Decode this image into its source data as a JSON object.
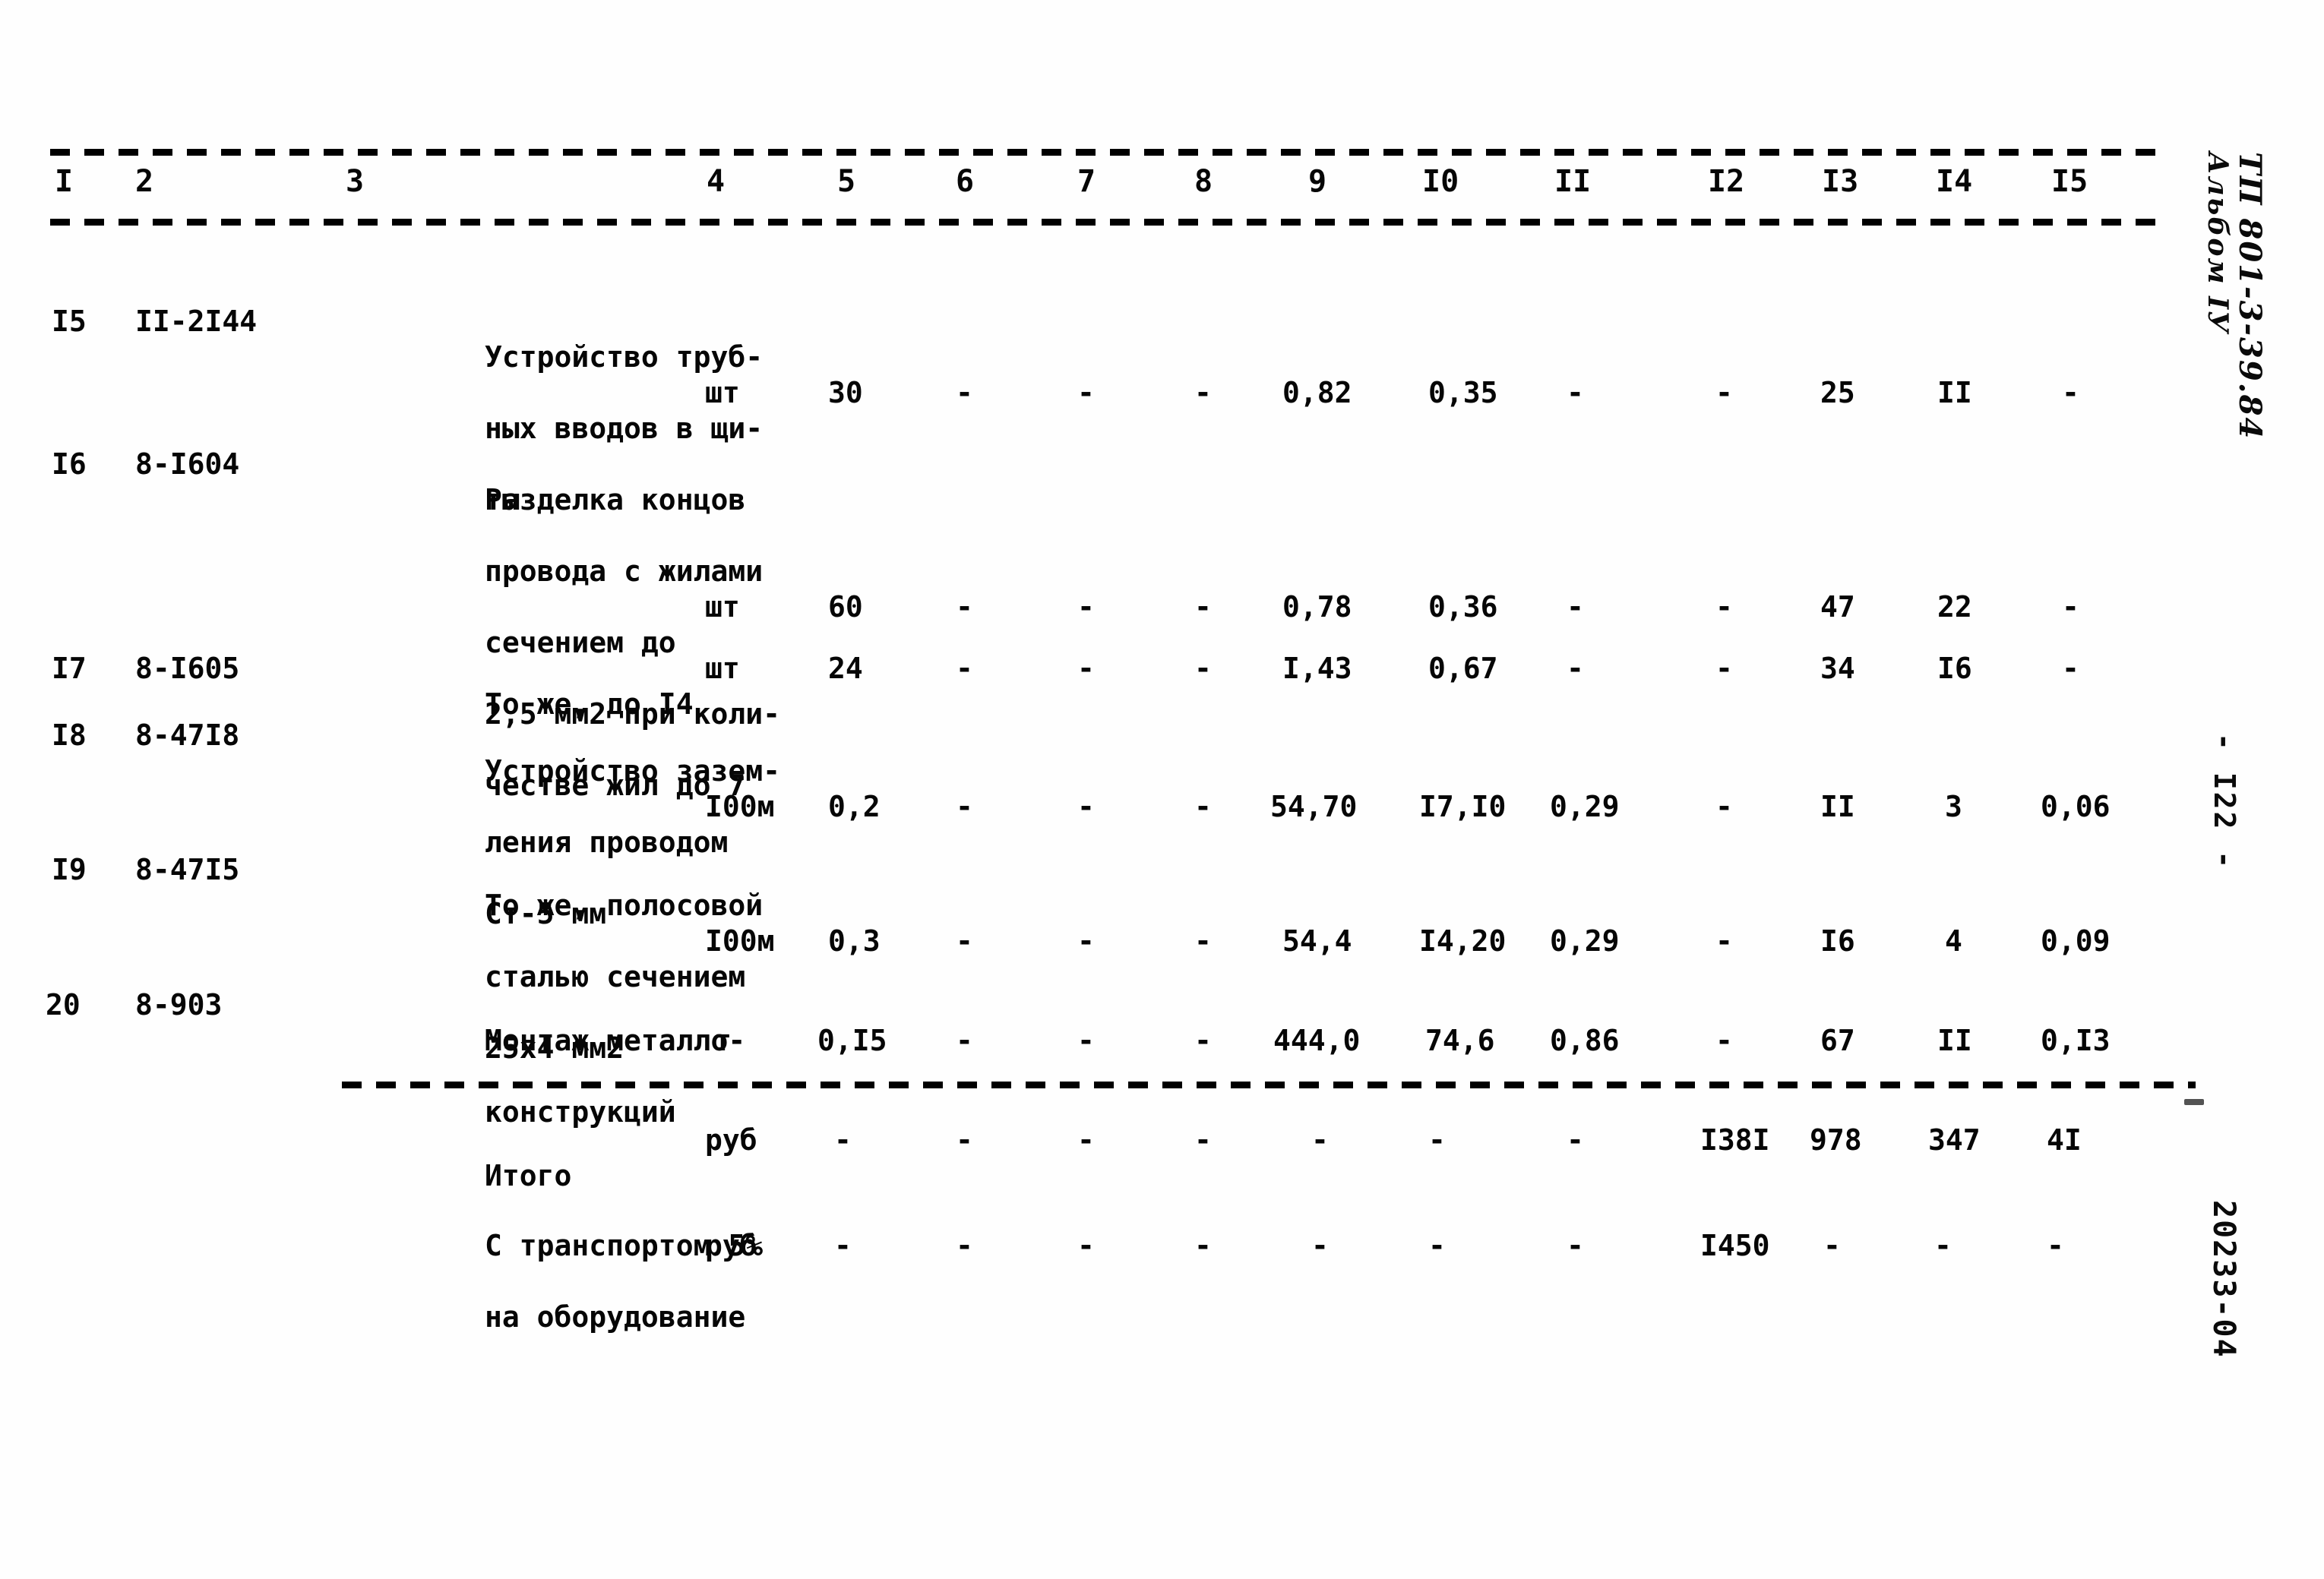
{
  "document": {
    "type": "scanned-cost-estimate-table",
    "page_label": "- I22 -",
    "margin_code_top": "ТП 801-3-39.84",
    "margin_code_album": "Альбом IУ",
    "margin_stamp": "20233-04"
  },
  "table": {
    "column_headers": [
      "I",
      "2",
      "3",
      "4",
      "5",
      "6",
      "7",
      "8",
      "9",
      "I0",
      "II",
      "I2",
      "I3",
      "I4",
      "I5"
    ],
    "rows": [
      {
        "num": "I5",
        "code": "II-2I44",
        "desc_lines": [
          "Устройство труб-",
          "ных вводов в щи-",
          "ты"
        ],
        "unit": "шт",
        "c5": "30",
        "c6": "-",
        "c7": "-",
        "c8": "-",
        "c9": "0,82",
        "c10": "0,35",
        "c11": "-",
        "c12": "-",
        "c13": "25",
        "c14": "II",
        "c15": "-"
      },
      {
        "num": "I6",
        "code": "8-I604",
        "desc_lines": [
          "Разделка концов",
          "провода с жилами",
          "сечением до",
          "2,5 мм2 при коли-",
          "честве жил до 7"
        ],
        "unit": "шт",
        "c5": "60",
        "c6": "-",
        "c7": "-",
        "c8": "-",
        "c9": "0,78",
        "c10": "0,36",
        "c11": "-",
        "c12": "-",
        "c13": "47",
        "c14": "22",
        "c15": "-"
      },
      {
        "num": "I7",
        "code": "8-I605",
        "desc_lines": [
          "То же, до I4"
        ],
        "unit": "шт",
        "c5": "24",
        "c6": "-",
        "c7": "-",
        "c8": "-",
        "c9": "I,43",
        "c10": "0,67",
        "c11": "-",
        "c12": "-",
        "c13": "34",
        "c14": "I6",
        "c15": "-"
      },
      {
        "num": "I8",
        "code": "8-47I8",
        "desc_lines": [
          "Устройство зазем-",
          "ления проводом",
          "Ст-5 мм"
        ],
        "unit": "I00м",
        "c5": "0,2",
        "c6": "-",
        "c7": "-",
        "c8": "-",
        "c9": "54,70",
        "c10": "I7,I0",
        "c11": "0,29",
        "c12": "-",
        "c13": "II",
        "c14": "3",
        "c15": "0,06"
      },
      {
        "num": "I9",
        "code": "8-47I5",
        "desc_lines": [
          "То же, полосовой",
          "сталью сечением",
          "25х4 мм2"
        ],
        "unit": "I00м",
        "c5": "0,3",
        "c6": "-",
        "c7": "-",
        "c8": "-",
        "c9": "54,4",
        "c10": "I4,20",
        "c11": "0,29",
        "c12": "-",
        "c13": "I6",
        "c14": "4",
        "c15": "0,09"
      },
      {
        "num": "20",
        "code": "8-903",
        "desc_lines": [
          "Монтаж металло-",
          "конструкций"
        ],
        "unit": "т",
        "c5": "0,I5",
        "c6": "-",
        "c7": "-",
        "c8": "-",
        "c9": "444,0",
        "c10": "74,6",
        "c11": "0,86",
        "c12": "-",
        "c13": "67",
        "c14": "II",
        "c15": "0,I3"
      }
    ],
    "summary_rows": [
      {
        "label_lines": [
          "Итого"
        ],
        "unit": "руб",
        "c5": "-",
        "c6": "-",
        "c7": "-",
        "c8": "-",
        "c9": "-",
        "c10": "-",
        "c11": "-",
        "c12": "I38I",
        "c13": "978",
        "c14": "347",
        "c15": "4I"
      },
      {
        "label_lines": [
          "С транспортом 5%",
          "на оборудование"
        ],
        "unit": "руб",
        "c5": "-",
        "c6": "-",
        "c7": "-",
        "c8": "-",
        "c9": "-",
        "c10": "-",
        "c11": "-",
        "c12": "I450",
        "c13": "-",
        "c14": "-",
        "c15": "-"
      }
    ]
  }
}
